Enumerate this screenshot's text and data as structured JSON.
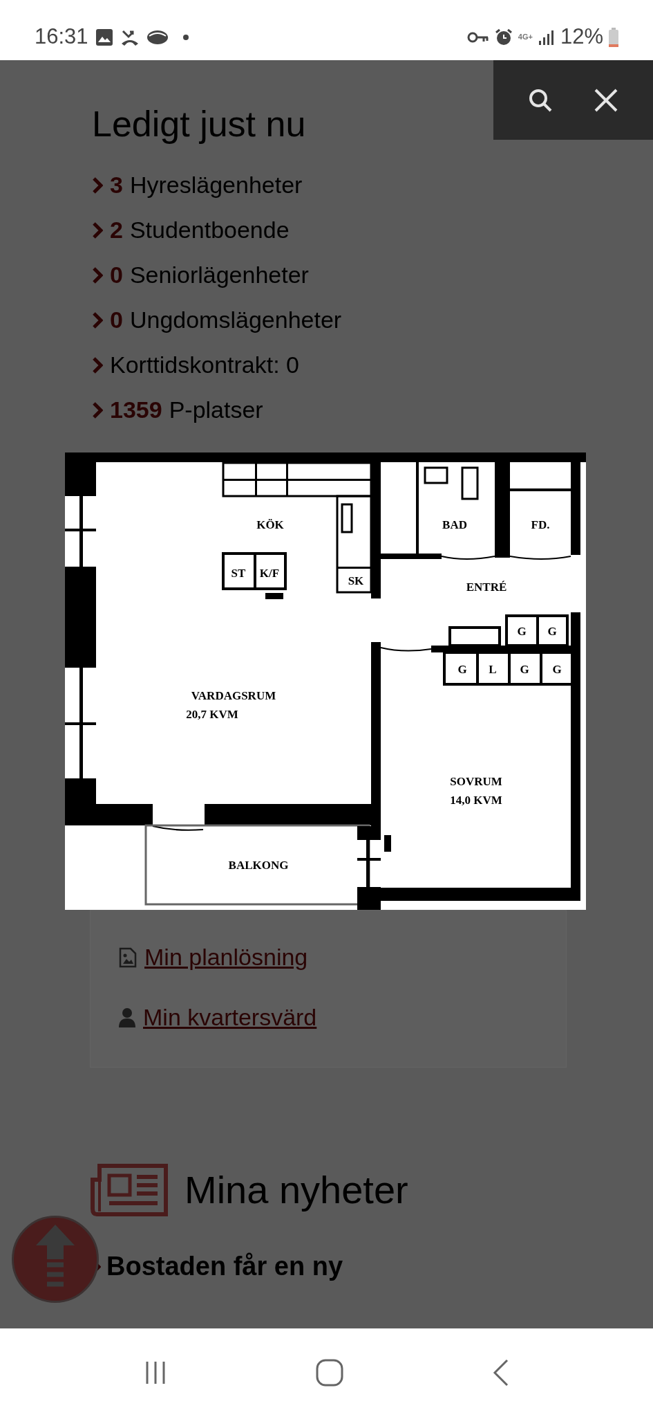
{
  "status_bar": {
    "time": "16:31",
    "network": "4G+",
    "battery": "12%"
  },
  "heading": "Ledigt just nu",
  "availability": [
    {
      "count": "3",
      "label": "Hyreslägenheter"
    },
    {
      "count": "2",
      "label": "Studentboende"
    },
    {
      "count": "0",
      "label": "Seniorlägenheter"
    },
    {
      "count": "0",
      "label": "Ungdomslägenheter"
    },
    {
      "label": "Korttidskontrakt: 0"
    },
    {
      "count": "1359",
      "label": "P-platser"
    }
  ],
  "floor_plan": {
    "rooms": [
      "KÖK",
      "BAD",
      "FD.",
      "ENTRÉ",
      "VARDAGSRUM",
      "20,7 KVM",
      "SOVRUM",
      "14,0 KVM",
      "BALKONG"
    ],
    "fixtures": [
      "ST",
      "K/F",
      "SK",
      "G",
      "G",
      "G",
      "L",
      "G",
      "G"
    ]
  },
  "links": [
    {
      "kind": "image",
      "label": "Min planlösning"
    },
    {
      "kind": "person",
      "label": "Min kvartersvärd"
    }
  ],
  "news": {
    "title": "Mina nyheter",
    "items": [
      "Bostaden får en ny"
    ]
  }
}
